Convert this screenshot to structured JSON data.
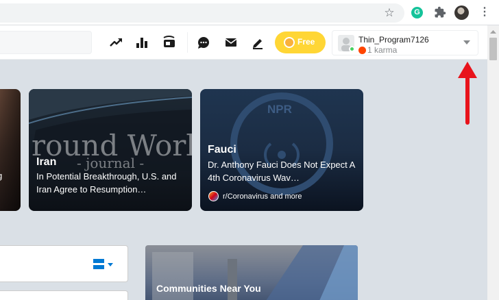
{
  "browser": {
    "extension_letter": "G"
  },
  "header": {
    "free_label": "Free",
    "username": "Thin_Program7126",
    "karma": "1 karma"
  },
  "cards": [
    {
      "title": "Iran",
      "text": "In Potential Breakthrough, U.S. and Iran Agree to Resumption…",
      "watermark_line1": "round Worl",
      "watermark_line2": "- journal -"
    },
    {
      "title": "Fauci",
      "text": "Dr. Anthony Fauci Does Not Expect A 4th Coronavirus Wav…",
      "logo_text": "NPR",
      "subreddit": "r/Coronavirus and more"
    }
  ],
  "left_card_text": "g",
  "sidebar": {
    "communities_title": "Communities Near You"
  },
  "colors": {
    "reddit_orange": "#ff4500",
    "premium_yellow": "#ffd635",
    "reddit_blue": "#0079d3",
    "annotation_red": "#e8131b"
  }
}
